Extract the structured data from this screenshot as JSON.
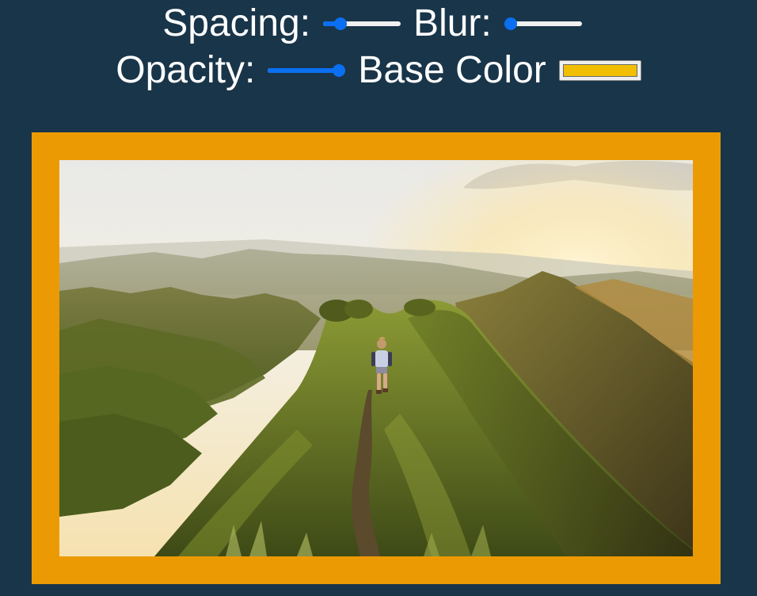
{
  "controls": {
    "spacing": {
      "label": "Spacing:",
      "value_fraction": 0.22
    },
    "blur": {
      "label": "Blur:",
      "value_fraction": 0.06
    },
    "opacity": {
      "label": "Opacity:",
      "value_fraction": 0.93
    },
    "base_color": {
      "label": "Base Color",
      "value": "#f1bf00"
    }
  },
  "frame": {
    "color": "#ec9a04"
  },
  "colors": {
    "background": "#193549",
    "slider_accent": "#0b6ff2",
    "slider_track": "#f0f0f0"
  },
  "image": {
    "subject": "hiker walking along a grassy mountain ridge at sunrise"
  }
}
